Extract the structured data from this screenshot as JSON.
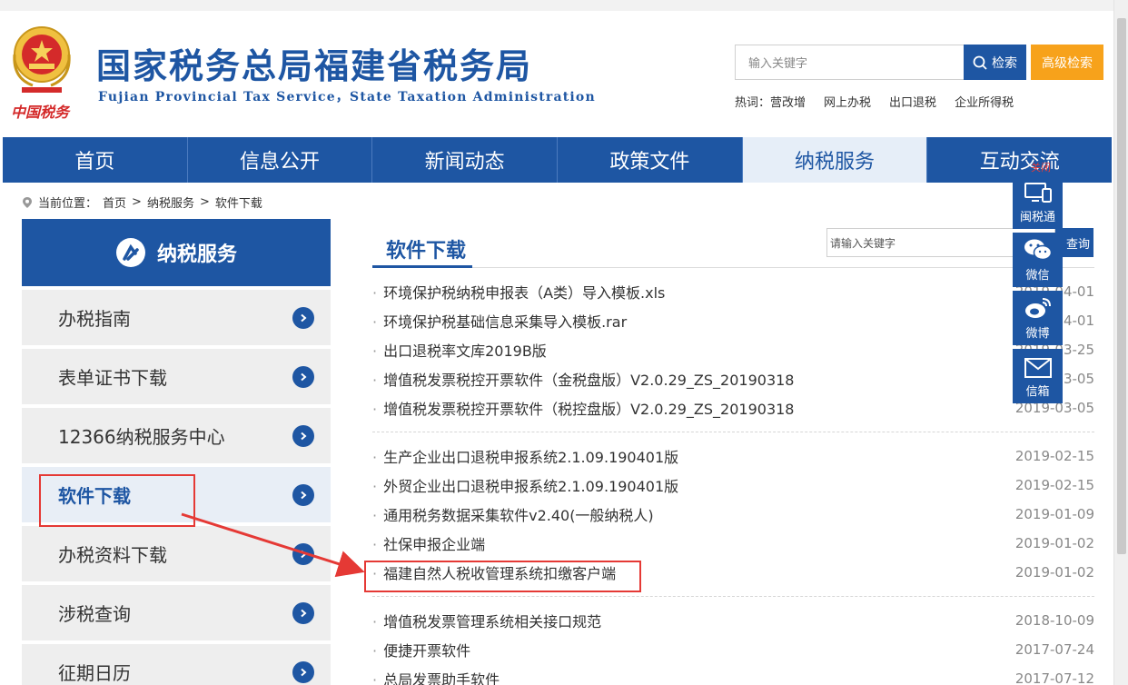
{
  "header": {
    "title": "国家税务总局福建省税务局",
    "subtitle": "Fujian Provincial Tax Service，State Taxation Administration",
    "emblem_text": "中国税务",
    "search_placeholder": "输入关键字",
    "search_button": "检索",
    "advanced_search_button": "高级检索",
    "hot_label": "热词：",
    "hot_words": [
      "营改增",
      "网上办税",
      "出口退税",
      "企业所得税"
    ]
  },
  "nav": {
    "items": [
      "首页",
      "信息公开",
      "新闻动态",
      "政策文件",
      "纳税服务",
      "互动交流"
    ],
    "active_index": 4
  },
  "breadcrumb": {
    "label": "当前位置：",
    "items": [
      "首页",
      "纳税服务",
      "软件下载"
    ],
    "separator": ">"
  },
  "sidebar": {
    "title": "纳税服务",
    "items": [
      "办税指南",
      "表单证书下载",
      "12366纳税服务中心",
      "软件下载",
      "办税资料下载",
      "涉税查询",
      "征期日历"
    ],
    "active_index": 3
  },
  "content": {
    "title": "软件下载",
    "search_placeholder": "请输入关键字",
    "search_button": "查询",
    "groups": [
      [
        {
          "name": "环境保护税纳税申报表（A类）导入模板.xls",
          "date": "2019-04-01"
        },
        {
          "name": "环境保护税基础信息采集导入模板.rar",
          "date": "2019-04-01"
        },
        {
          "name": "出口退税率文库2019B版",
          "date": "2019-03-25"
        },
        {
          "name": "增值税发票税控开票软件（金税盘版）V2.0.29_ZS_20190318",
          "date": "2019-03-05"
        },
        {
          "name": "增值税发票税控开票软件（税控盘版）V2.0.29_ZS_20190318",
          "date": "2019-03-05"
        }
      ],
      [
        {
          "name": "生产企业出口退税申报系统2.1.09.190401版",
          "date": "2019-02-15"
        },
        {
          "name": "外贸企业出口退税申报系统2.1.09.190401版",
          "date": "2019-02-15"
        },
        {
          "name": "通用税务数据采集软件v2.40(一般纳税人)",
          "date": "2019-01-09"
        },
        {
          "name": "社保申报企业端",
          "date": "2019-01-02"
        },
        {
          "name": "福建自然人税收管理系统扣缴客户端",
          "date": "2019-01-02"
        }
      ],
      [
        {
          "name": "增值税发票管理系统相关接口规范",
          "date": "2018-10-09"
        },
        {
          "name": "便捷开票软件",
          "date": "2017-07-24"
        },
        {
          "name": "总局发票助手软件",
          "date": "2017-07-12"
        }
      ]
    ]
  },
  "float_bar": {
    "close_label": "关闭",
    "items": [
      {
        "label": "闽税通",
        "icon": "monitor-phone-icon"
      },
      {
        "label": "微信",
        "icon": "wechat-icon"
      },
      {
        "label": "微博",
        "icon": "weibo-icon"
      },
      {
        "label": "信箱",
        "icon": "mail-icon"
      }
    ]
  },
  "colors": {
    "brand_blue": "#1e56a3",
    "accent_orange": "#f7a21b",
    "annotation_red": "#e53935"
  }
}
